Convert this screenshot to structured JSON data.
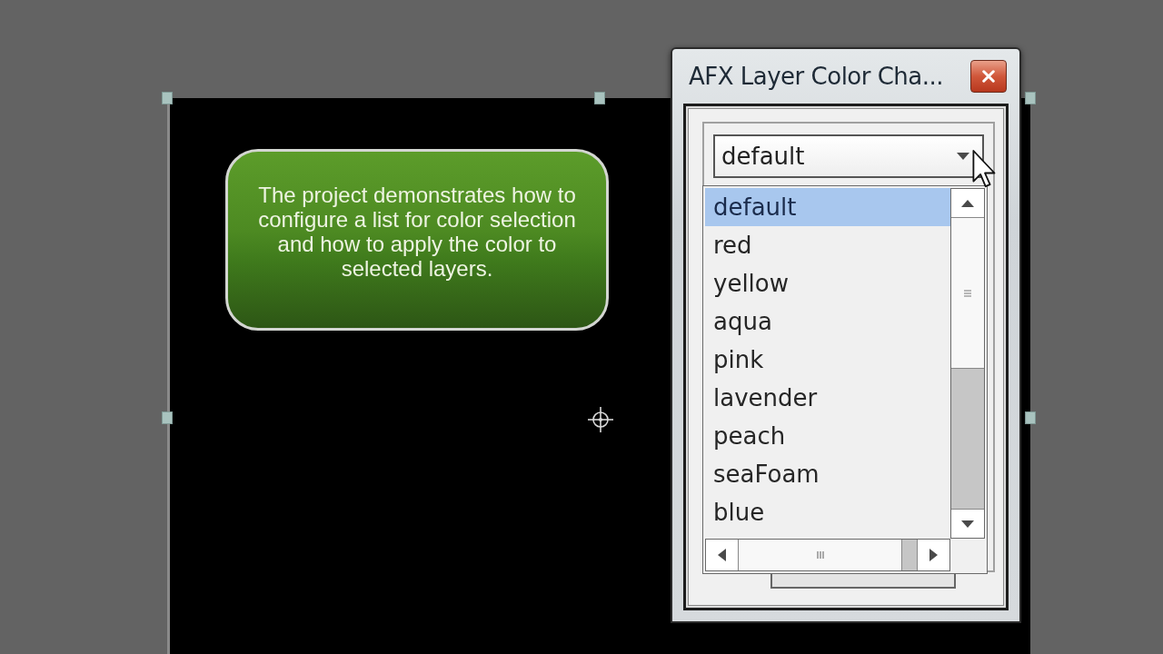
{
  "composition": {
    "callout": {
      "text": "The project demonstrates how to configure a list for color selection and how to apply the color to selected layers."
    }
  },
  "dialog": {
    "title": "AFX Layer Color Cha...",
    "dropdown": {
      "value": "default",
      "expanded": true,
      "options": [
        {
          "label": "default",
          "selected": true
        },
        {
          "label": "red",
          "selected": false
        },
        {
          "label": "yellow",
          "selected": false
        },
        {
          "label": "aqua",
          "selected": false
        },
        {
          "label": "pink",
          "selected": false
        },
        {
          "label": "lavender",
          "selected": false
        },
        {
          "label": "peach",
          "selected": false
        },
        {
          "label": "seaFoam",
          "selected": false
        },
        {
          "label": "blue",
          "selected": false
        }
      ]
    }
  }
}
